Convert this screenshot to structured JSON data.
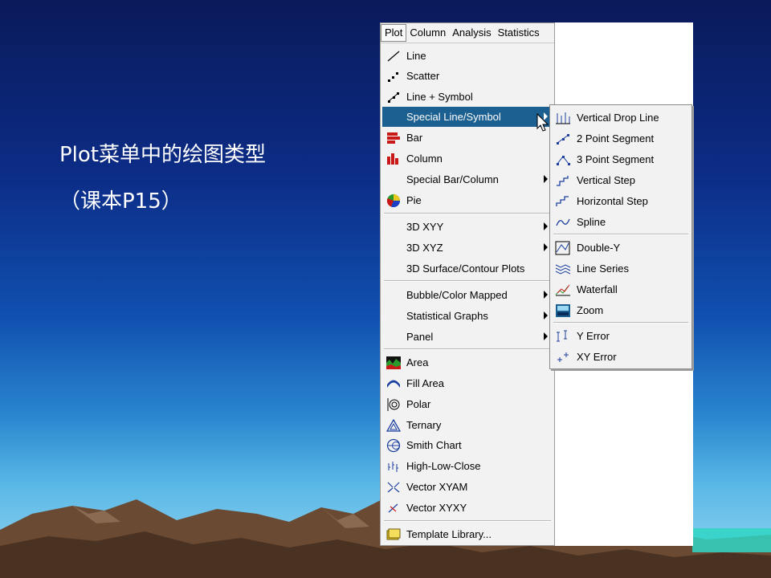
{
  "slide": {
    "title": "Plot菜单中的绘图类型",
    "subtitle": "（课本P15）"
  },
  "menubar": [
    "Plot",
    "Column",
    "Analysis",
    "Statistics"
  ],
  "plot_menu": [
    {
      "label": "Line",
      "icon": "line-icon"
    },
    {
      "label": "Scatter",
      "icon": "scatter-icon"
    },
    {
      "label": "Line + Symbol",
      "icon": "line-symbol-icon"
    },
    {
      "label": "Special Line/Symbol",
      "submenu": true,
      "highlight": true
    },
    {
      "label": "Bar",
      "icon": "bar-icon"
    },
    {
      "label": "Column",
      "icon": "column-icon"
    },
    {
      "label": "Special Bar/Column",
      "submenu": true
    },
    {
      "label": "Pie",
      "icon": "pie-icon"
    },
    {
      "label": "3D XYY",
      "submenu": true
    },
    {
      "label": "3D XYZ",
      "submenu": true
    },
    {
      "label": "3D Surface/Contour Plots"
    },
    {
      "label": "Bubble/Color Mapped",
      "submenu": true
    },
    {
      "label": "Statistical Graphs",
      "submenu": true
    },
    {
      "label": "Panel",
      "submenu": true
    },
    {
      "label": "Area",
      "icon": "area-icon"
    },
    {
      "label": "Fill Area",
      "icon": "fill-area-icon"
    },
    {
      "label": "Polar",
      "icon": "polar-icon"
    },
    {
      "label": "Ternary",
      "icon": "ternary-icon"
    },
    {
      "label": "Smith Chart",
      "icon": "smith-chart-icon"
    },
    {
      "label": "High-Low-Close",
      "icon": "high-low-close-icon"
    },
    {
      "label": "Vector XYAM",
      "icon": "vector-xyam-icon"
    },
    {
      "label": "Vector XYXY",
      "icon": "vector-xyxy-icon"
    },
    {
      "label": "Template Library...",
      "icon": "template-library-icon"
    }
  ],
  "submenu": [
    {
      "label": "Vertical Drop Line",
      "icon": "vertical-drop-line-icon"
    },
    {
      "label": "2 Point Segment",
      "icon": "two-point-segment-icon"
    },
    {
      "label": "3 Point Segment",
      "icon": "three-point-segment-icon"
    },
    {
      "label": "Vertical Step",
      "icon": "vertical-step-icon"
    },
    {
      "label": "Horizontal Step",
      "icon": "horizontal-step-icon"
    },
    {
      "label": "Spline",
      "icon": "spline-icon"
    },
    {
      "label": "Double-Y",
      "icon": "double-y-icon"
    },
    {
      "label": "Line Series",
      "icon": "line-series-icon"
    },
    {
      "label": "Waterfall",
      "icon": "waterfall-icon"
    },
    {
      "label": "Zoom",
      "icon": "zoom-icon"
    },
    {
      "label": "Y Error",
      "icon": "y-error-icon"
    },
    {
      "label": "XY Error",
      "icon": "xy-error-icon"
    }
  ],
  "colors": {
    "highlight": "#1c5f91",
    "menu_bg": "#f2f2f2"
  }
}
